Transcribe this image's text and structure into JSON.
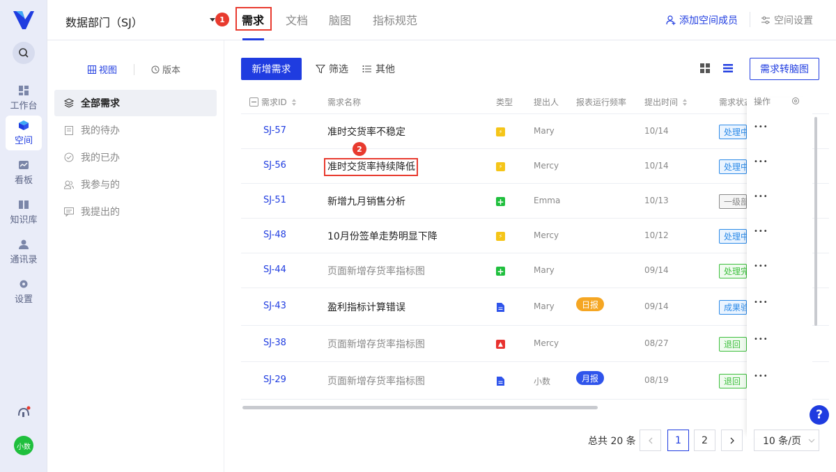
{
  "workspace": {
    "name": "数据部门（SJ）"
  },
  "tabs": [
    {
      "label": "需求",
      "active": true
    },
    {
      "label": "文档",
      "active": false
    },
    {
      "label": "脑图",
      "active": false
    },
    {
      "label": "指标规范",
      "active": false
    }
  ],
  "annotations": {
    "one": "1",
    "two": "2"
  },
  "header_actions": {
    "add_member": "添加空间成员",
    "settings": "空间设置"
  },
  "rail": {
    "items": [
      {
        "label": "工作台",
        "icon": "grid-icon"
      },
      {
        "label": "空间",
        "icon": "cube-icon",
        "active": true
      },
      {
        "label": "看板",
        "icon": "dashboard-icon"
      },
      {
        "label": "知识库",
        "icon": "book-icon"
      },
      {
        "label": "通讯录",
        "icon": "contacts-icon"
      },
      {
        "label": "设置",
        "icon": "gear-icon"
      }
    ],
    "avatar": "小数"
  },
  "sidebar": {
    "view_tabs": {
      "view": "视图",
      "version": "版本"
    },
    "items": [
      {
        "label": "全部需求",
        "active": true
      },
      {
        "label": "我的待办"
      },
      {
        "label": "我的已办"
      },
      {
        "label": "我参与的"
      },
      {
        "label": "我提出的"
      }
    ]
  },
  "toolbar": {
    "new": "新增需求",
    "filter": "筛选",
    "other": "其他",
    "convert": "需求转脑图"
  },
  "table": {
    "columns": {
      "id": "需求ID",
      "name": "需求名称",
      "type": "类型",
      "proposer": "提出人",
      "freq": "报表运行频率",
      "time": "提出时间",
      "status": "需求状态",
      "ops": "操作"
    },
    "rows": [
      {
        "id": "SJ-57",
        "name": "准时交货率不稳定",
        "muted": false,
        "type": "bolt",
        "proposer": "Mary",
        "freq": "",
        "date": "10/14",
        "status": "处理中",
        "status_color": "#2b8ae8"
      },
      {
        "id": "SJ-56",
        "name": "准时交货率持续降低",
        "muted": false,
        "type": "bolt",
        "proposer": "Mercy",
        "freq": "",
        "date": "10/14",
        "status": "处理中",
        "status_color": "#2b8ae8"
      },
      {
        "id": "SJ-51",
        "name": "新增九月销售分析",
        "muted": false,
        "type": "plus",
        "proposer": "Emma",
        "freq": "",
        "date": "10/13",
        "status": "一级部",
        "status_color": "#888888"
      },
      {
        "id": "SJ-48",
        "name": "10月份签单走势明显下降",
        "muted": false,
        "type": "bolt",
        "proposer": "Mercy",
        "freq": "",
        "date": "10/12",
        "status": "处理中",
        "status_color": "#2b8ae8"
      },
      {
        "id": "SJ-44",
        "name": "页面新增存货率指标图",
        "muted": true,
        "type": "plus",
        "proposer": "Mary",
        "freq": "",
        "date": "09/14",
        "status": "处理完",
        "status_color": "#3cbf3c"
      },
      {
        "id": "SJ-43",
        "name": "盈利指标计算错误",
        "muted": false,
        "type": "doc",
        "proposer": "Mary",
        "freq": "日报",
        "freq_color": "#f5a623",
        "date": "09/14",
        "status": "成果验",
        "status_color": "#2b8ae8"
      },
      {
        "id": "SJ-38",
        "name": "页面新增存货率指标图",
        "muted": true,
        "type": "warn",
        "proposer": "Mercy",
        "freq": "",
        "date": "08/27",
        "status": "退回",
        "status_color": "#3cbf3c"
      },
      {
        "id": "SJ-29",
        "name": "页面新增存货率指标图",
        "muted": true,
        "type": "doc",
        "proposer": "小数",
        "freq": "月报",
        "freq_color": "#2f54eb",
        "date": "08/19",
        "status": "退回",
        "status_color": "#3cbf3c"
      }
    ]
  },
  "pagination": {
    "total": "总共 20 条",
    "pages": [
      "1",
      "2"
    ],
    "current": "1",
    "page_size": "10 条/页"
  },
  "colors": {
    "accent": "#1f3ce0",
    "annotation": "#e83a2e",
    "bolt": "#f5c518",
    "plus": "#1fbf3d",
    "doc": "#2f54eb",
    "warn": "#e8312e"
  }
}
